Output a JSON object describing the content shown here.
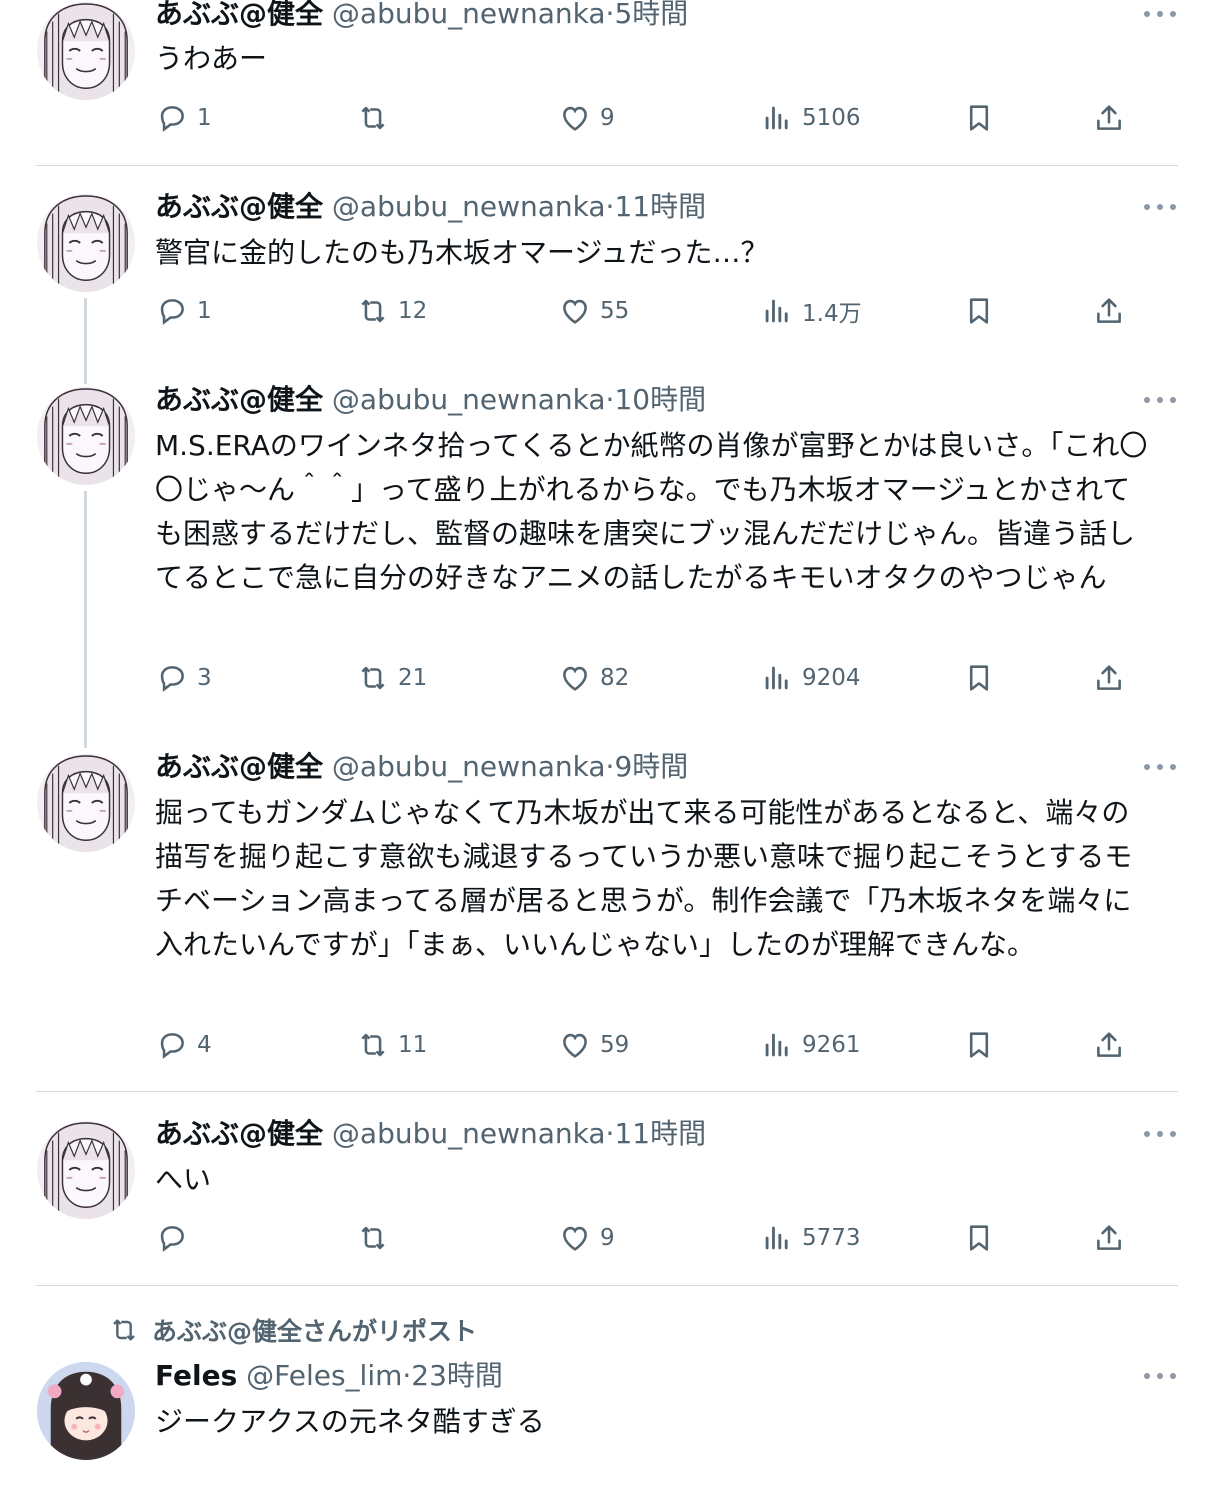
{
  "tweets": [
    {
      "name": "あぶぶ@健全",
      "handle": "@abubu_newnanka",
      "dot": "·",
      "time": "5時間",
      "text": "うわあー",
      "replies": "1",
      "reposts": "",
      "likes": "9",
      "views": "5106"
    },
    {
      "name": "あぶぶ@健全",
      "handle": "@abubu_newnanka",
      "dot": "·",
      "time": "11時間",
      "text": "警官に金的したのも乃木坂オマージュだった…？",
      "replies": "1",
      "reposts": "12",
      "likes": "55",
      "views": "1.4万"
    },
    {
      "name": "あぶぶ@健全",
      "handle": "@abubu_newnanka",
      "dot": "·",
      "time": "10時間",
      "text": "M.S.ERAのワインネタ拾ってくるとか紙幣の肖像が富野とかは良いさ。「これ〇〇じゃ〜ん＾＾」って盛り上がれるからな。でも乃木坂オマージュとかされても困惑するだけだし、監督の趣味を唐突にブッ混んだだけじゃん。皆違う話してるとこで急に自分の好きなアニメの話したがるキモいオタクのやつじゃん",
      "replies": "3",
      "reposts": "21",
      "likes": "82",
      "views": "9204"
    },
    {
      "name": "あぶぶ@健全",
      "handle": "@abubu_newnanka",
      "dot": "·",
      "time": "9時間",
      "text": "掘ってもガンダムじゃなくて乃木坂が出て来る可能性があるとなると、端々の描写を掘り起こす意欲も減退するっていうか悪い意味で掘り起こそうとするモチベーション高まってる層が居ると思うが。制作会議で「乃木坂ネタを端々に入れたいんですが」「まぁ、いいんじゃない」したのが理解できんな。",
      "replies": "4",
      "reposts": "11",
      "likes": "59",
      "views": "9261"
    },
    {
      "name": "あぶぶ@健全",
      "handle": "@abubu_newnanka",
      "dot": "·",
      "time": "11時間",
      "text": "へい",
      "replies": "",
      "reposts": "",
      "likes": "9",
      "views": "5773"
    }
  ],
  "repost": {
    "label": "あぶぶ@健全さんがリポスト",
    "name": "Feles",
    "handle": "@Feles_lim",
    "dot": "·",
    "time": "23時間",
    "text": "ジークアクスの元ネタ酷すぎる"
  },
  "icons": [
    "reply-icon",
    "repost-icon",
    "like-icon",
    "views-icon",
    "bookmark-icon",
    "share-icon",
    "more-icon"
  ],
  "colors": {
    "text": "#0f1419",
    "secondary": "#536471",
    "separator": "#d6dbdf",
    "thread": "#cfd9de"
  }
}
